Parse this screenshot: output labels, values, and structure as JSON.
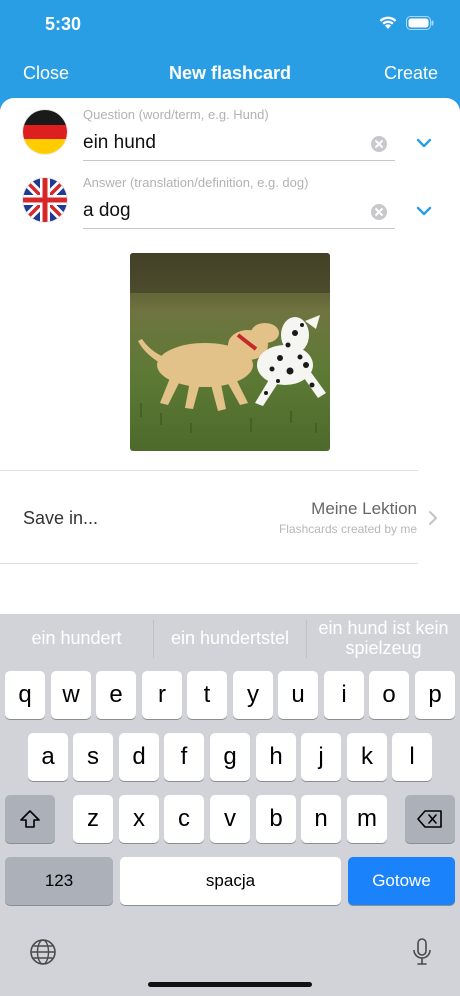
{
  "status": {
    "time": "5:30"
  },
  "nav": {
    "close": "Close",
    "title": "New flashcard",
    "create": "Create"
  },
  "question": {
    "placeholder": "Question (word/term, e.g. Hund)",
    "value": "ein hund",
    "flag": "german-flag-icon"
  },
  "answer": {
    "placeholder": "Answer (translation/definition, e.g. dog)",
    "value": "a dog",
    "flag": "uk-flag-icon"
  },
  "save": {
    "label": "Save in...",
    "value": "Meine Lektion",
    "sub": "Flashcards created by me"
  },
  "keyboard": {
    "suggestions": [
      "ein hundert",
      "ein hundertstel",
      "ein hund ist kein spielzeug"
    ],
    "row1": [
      "q",
      "w",
      "e",
      "r",
      "t",
      "y",
      "u",
      "i",
      "o",
      "p"
    ],
    "row2": [
      "a",
      "s",
      "d",
      "f",
      "g",
      "h",
      "j",
      "k",
      "l"
    ],
    "row3": [
      "z",
      "x",
      "c",
      "v",
      "b",
      "n",
      "m"
    ],
    "numbers_label": "123",
    "space_label": "spacja",
    "done_label": "Gotowe"
  },
  "colors": {
    "header": "#2a9ee5",
    "accent": "#1a82fb",
    "chevron": "#2a9ee5"
  }
}
